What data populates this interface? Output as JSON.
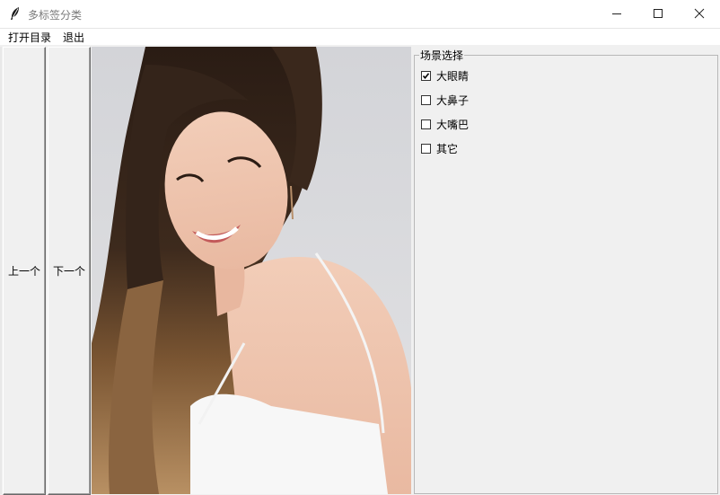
{
  "window": {
    "title": "多标签分类"
  },
  "menu": {
    "items": [
      {
        "label": "打开目录"
      },
      {
        "label": "退出"
      }
    ]
  },
  "nav": {
    "prev_label": "上一个",
    "next_label": "下一个"
  },
  "panel": {
    "title": "场景选择",
    "options": [
      {
        "label": "大眼睛",
        "checked": true
      },
      {
        "label": "大鼻子",
        "checked": false
      },
      {
        "label": "大嘴巴",
        "checked": false
      },
      {
        "label": "其它",
        "checked": false
      }
    ]
  },
  "icons": {
    "app": "feather-icon",
    "minimize": "minimize-icon",
    "maximize": "maximize-icon",
    "close": "close-icon"
  }
}
